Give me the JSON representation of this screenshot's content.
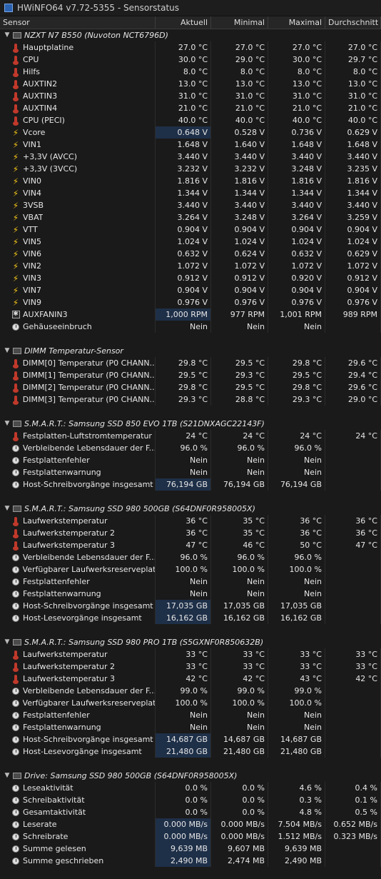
{
  "window": {
    "title": "HWiNFO64 v7.72-5355 - Sensorstatus"
  },
  "columns": [
    "Sensor",
    "Aktuell",
    "Minimal",
    "Maximal",
    "Durchschnitt"
  ],
  "groups": [
    {
      "title": "NZXT N7 B550 (Nuvoton NCT6796D)",
      "rows": [
        {
          "icon": "thermometer-icon",
          "label": "Hauptplatine",
          "values": [
            "27.0 °C",
            "27.0 °C",
            "27.0 °C",
            "27.0 °C"
          ]
        },
        {
          "icon": "thermometer-icon",
          "label": "CPU",
          "values": [
            "30.0 °C",
            "29.0 °C",
            "30.0 °C",
            "29.7 °C"
          ]
        },
        {
          "icon": "thermometer-icon",
          "label": "Hilfs",
          "values": [
            "8.0 °C",
            "8.0 °C",
            "8.0 °C",
            "8.0 °C"
          ]
        },
        {
          "icon": "thermometer-icon",
          "label": "AUXTIN2",
          "values": [
            "13.0 °C",
            "13.0 °C",
            "13.0 °C",
            "13.0 °C"
          ]
        },
        {
          "icon": "thermometer-icon",
          "label": "AUXTIN3",
          "values": [
            "31.0 °C",
            "31.0 °C",
            "31.0 °C",
            "31.0 °C"
          ]
        },
        {
          "icon": "thermometer-icon",
          "label": "AUXTIN4",
          "values": [
            "21.0 °C",
            "21.0 °C",
            "21.0 °C",
            "21.0 °C"
          ]
        },
        {
          "icon": "thermometer-icon",
          "label": "CPU (PECI)",
          "values": [
            "40.0 °C",
            "40.0 °C",
            "40.0 °C",
            "40.0 °C"
          ]
        },
        {
          "icon": "bolt-icon",
          "label": "Vcore",
          "values": [
            "0.648 V",
            "0.528 V",
            "0.736 V",
            "0.629 V"
          ],
          "hl": true
        },
        {
          "icon": "bolt-icon",
          "label": "VIN1",
          "values": [
            "1.648 V",
            "1.640 V",
            "1.648 V",
            "1.648 V"
          ]
        },
        {
          "icon": "bolt-icon",
          "label": "+3,3V (AVCC)",
          "values": [
            "3.440 V",
            "3.440 V",
            "3.440 V",
            "3.440 V"
          ]
        },
        {
          "icon": "bolt-icon",
          "label": "+3,3V (3VCC)",
          "values": [
            "3.232 V",
            "3.232 V",
            "3.248 V",
            "3.235 V"
          ]
        },
        {
          "icon": "bolt-icon",
          "label": "VIN0",
          "values": [
            "1.816 V",
            "1.816 V",
            "1.816 V",
            "1.816 V"
          ]
        },
        {
          "icon": "bolt-icon",
          "label": "VIN4",
          "values": [
            "1.344 V",
            "1.344 V",
            "1.344 V",
            "1.344 V"
          ]
        },
        {
          "icon": "bolt-icon",
          "label": "3VSB",
          "values": [
            "3.440 V",
            "3.440 V",
            "3.440 V",
            "3.440 V"
          ]
        },
        {
          "icon": "bolt-icon",
          "label": "VBAT",
          "values": [
            "3.264 V",
            "3.248 V",
            "3.264 V",
            "3.259 V"
          ]
        },
        {
          "icon": "bolt-icon",
          "label": "VTT",
          "values": [
            "0.904 V",
            "0.904 V",
            "0.904 V",
            "0.904 V"
          ]
        },
        {
          "icon": "bolt-icon",
          "label": "VIN5",
          "values": [
            "1.024 V",
            "1.024 V",
            "1.024 V",
            "1.024 V"
          ]
        },
        {
          "icon": "bolt-icon",
          "label": "VIN6",
          "values": [
            "0.632 V",
            "0.624 V",
            "0.632 V",
            "0.629 V"
          ]
        },
        {
          "icon": "bolt-icon",
          "label": "VIN2",
          "values": [
            "1.072 V",
            "1.072 V",
            "1.072 V",
            "1.072 V"
          ]
        },
        {
          "icon": "bolt-icon",
          "label": "VIN3",
          "values": [
            "0.912 V",
            "0.912 V",
            "0.920 V",
            "0.912 V"
          ]
        },
        {
          "icon": "bolt-icon",
          "label": "VIN7",
          "values": [
            "0.904 V",
            "0.904 V",
            "0.904 V",
            "0.904 V"
          ]
        },
        {
          "icon": "bolt-icon",
          "label": "VIN9",
          "values": [
            "0.976 V",
            "0.976 V",
            "0.976 V",
            "0.976 V"
          ]
        },
        {
          "icon": "fan-icon",
          "label": "AUXFANIN3",
          "values": [
            "1,000 RPM",
            "977 RPM",
            "1,001 RPM",
            "989 RPM"
          ],
          "hl": true
        },
        {
          "icon": "clock-icon",
          "label": "Gehäuseeinbruch",
          "values": [
            "Nein",
            "Nein",
            "Nein",
            ""
          ]
        }
      ]
    },
    {
      "title": "DIMM Temperatur-Sensor",
      "rows": [
        {
          "icon": "thermometer-icon",
          "label": "DIMM[0] Temperatur (P0 CHANN...",
          "values": [
            "29.8 °C",
            "29.5 °C",
            "29.8 °C",
            "29.6 °C"
          ]
        },
        {
          "icon": "thermometer-icon",
          "label": "DIMM[1] Temperatur (P0 CHANN...",
          "values": [
            "29.5 °C",
            "29.3 °C",
            "29.5 °C",
            "29.4 °C"
          ]
        },
        {
          "icon": "thermometer-icon",
          "label": "DIMM[2] Temperatur (P0 CHANN...",
          "values": [
            "29.8 °C",
            "29.5 °C",
            "29.8 °C",
            "29.6 °C"
          ]
        },
        {
          "icon": "thermometer-icon",
          "label": "DIMM[3] Temperatur (P0 CHANN...",
          "values": [
            "29.3 °C",
            "28.8 °C",
            "29.3 °C",
            "29.0 °C"
          ]
        }
      ]
    },
    {
      "title": "S.M.A.R.T.: Samsung SSD 850 EVO 1TB (S21DNXAGC22143F)",
      "rows": [
        {
          "icon": "thermometer-icon",
          "label": "Festplatten-Luftstromtemperatur",
          "values": [
            "24 °C",
            "24 °C",
            "24 °C",
            "24 °C"
          ]
        },
        {
          "icon": "clock-icon",
          "label": "Verbleibende Lebensdauer der F...",
          "values": [
            "96.0 %",
            "96.0 %",
            "96.0 %",
            ""
          ]
        },
        {
          "icon": "clock-icon",
          "label": "Festplattenfehler",
          "values": [
            "Nein",
            "Nein",
            "Nein",
            ""
          ]
        },
        {
          "icon": "clock-icon",
          "label": "Festplattenwarnung",
          "values": [
            "Nein",
            "Nein",
            "Nein",
            ""
          ]
        },
        {
          "icon": "clock-icon",
          "label": "Host-Schreibvorgänge insgesamt",
          "values": [
            "76,194 GB",
            "76,194 GB",
            "76,194 GB",
            ""
          ],
          "hl": true
        }
      ]
    },
    {
      "title": "S.M.A.R.T.: Samsung SSD 980 500GB (S64DNF0R958005X)",
      "rows": [
        {
          "icon": "thermometer-icon",
          "label": "Laufwerkstemperatur",
          "values": [
            "36 °C",
            "35 °C",
            "36 °C",
            "36 °C"
          ]
        },
        {
          "icon": "thermometer-icon",
          "label": "Laufwerkstemperatur 2",
          "values": [
            "36 °C",
            "35 °C",
            "36 °C",
            "36 °C"
          ]
        },
        {
          "icon": "thermometer-icon",
          "label": "Laufwerkstemperatur 3",
          "values": [
            "47 °C",
            "46 °C",
            "50 °C",
            "47 °C"
          ]
        },
        {
          "icon": "clock-icon",
          "label": "Verbleibende Lebensdauer der F...",
          "values": [
            "96.0 %",
            "96.0 %",
            "96.0 %",
            ""
          ]
        },
        {
          "icon": "clock-icon",
          "label": "Verfügbarer Laufwerksreserveplatz",
          "values": [
            "100.0 %",
            "100.0 %",
            "100.0 %",
            ""
          ]
        },
        {
          "icon": "clock-icon",
          "label": "Festplattenfehler",
          "values": [
            "Nein",
            "Nein",
            "Nein",
            ""
          ]
        },
        {
          "icon": "clock-icon",
          "label": "Festplattenwarnung",
          "values": [
            "Nein",
            "Nein",
            "Nein",
            ""
          ]
        },
        {
          "icon": "clock-icon",
          "label": "Host-Schreibvorgänge insgesamt",
          "values": [
            "17,035 GB",
            "17,035 GB",
            "17,035 GB",
            ""
          ],
          "hl": true
        },
        {
          "icon": "clock-icon",
          "label": "Host-Lesevorgänge insgesamt",
          "values": [
            "16,162 GB",
            "16,162 GB",
            "16,162 GB",
            ""
          ],
          "hl": true
        }
      ]
    },
    {
      "title": "S.M.A.R.T.: Samsung SSD 980 PRO 1TB (S5GXNF0R850632B)",
      "rows": [
        {
          "icon": "thermometer-icon",
          "label": "Laufwerkstemperatur",
          "values": [
            "33 °C",
            "33 °C",
            "33 °C",
            "33 °C"
          ]
        },
        {
          "icon": "thermometer-icon",
          "label": "Laufwerkstemperatur 2",
          "values": [
            "33 °C",
            "33 °C",
            "33 °C",
            "33 °C"
          ]
        },
        {
          "icon": "thermometer-icon",
          "label": "Laufwerkstemperatur 3",
          "values": [
            "42 °C",
            "42 °C",
            "43 °C",
            "42 °C"
          ]
        },
        {
          "icon": "clock-icon",
          "label": "Verbleibende Lebensdauer der F...",
          "values": [
            "99.0 %",
            "99.0 %",
            "99.0 %",
            ""
          ]
        },
        {
          "icon": "clock-icon",
          "label": "Verfügbarer Laufwerksreserveplatz",
          "values": [
            "100.0 %",
            "100.0 %",
            "100.0 %",
            ""
          ]
        },
        {
          "icon": "clock-icon",
          "label": "Festplattenfehler",
          "values": [
            "Nein",
            "Nein",
            "Nein",
            ""
          ]
        },
        {
          "icon": "clock-icon",
          "label": "Festplattenwarnung",
          "values": [
            "Nein",
            "Nein",
            "Nein",
            ""
          ]
        },
        {
          "icon": "clock-icon",
          "label": "Host-Schreibvorgänge insgesamt",
          "values": [
            "14,687 GB",
            "14,687 GB",
            "14,687 GB",
            ""
          ],
          "hl": true
        },
        {
          "icon": "clock-icon",
          "label": "Host-Lesevorgänge insgesamt",
          "values": [
            "21,480 GB",
            "21,480 GB",
            "21,480 GB",
            ""
          ],
          "hl": true
        }
      ]
    },
    {
      "title": "Drive: Samsung SSD 980 500GB (S64DNF0R958005X)",
      "rows": [
        {
          "icon": "clock-icon",
          "label": "Leseaktivität",
          "values": [
            "0.0 %",
            "0.0 %",
            "4.6 %",
            "0.4 %"
          ]
        },
        {
          "icon": "clock-icon",
          "label": "Schreibaktivität",
          "values": [
            "0.0 %",
            "0.0 %",
            "0.3 %",
            "0.1 %"
          ]
        },
        {
          "icon": "clock-icon",
          "label": "Gesamtaktivität",
          "values": [
            "0.0 %",
            "0.0 %",
            "4.8 %",
            "0.5 %"
          ]
        },
        {
          "icon": "clock-icon",
          "label": "Leserate",
          "values": [
            "0.000 MB/s",
            "0.000 MB/s",
            "7.504 MB/s",
            "0.652 MB/s"
          ],
          "hl": true
        },
        {
          "icon": "clock-icon",
          "label": "Schreibrate",
          "values": [
            "0.000 MB/s",
            "0.000 MB/s",
            "1.512 MB/s",
            "0.323 MB/s"
          ],
          "hl": true
        },
        {
          "icon": "clock-icon",
          "label": "Summe gelesen",
          "values": [
            "9,639 MB",
            "9,607 MB",
            "9,639 MB",
            ""
          ],
          "hl": true
        },
        {
          "icon": "clock-icon",
          "label": "Summe geschrieben",
          "values": [
            "2,490 MB",
            "2,474 MB",
            "2,490 MB",
            ""
          ],
          "hl": true
        }
      ]
    }
  ]
}
